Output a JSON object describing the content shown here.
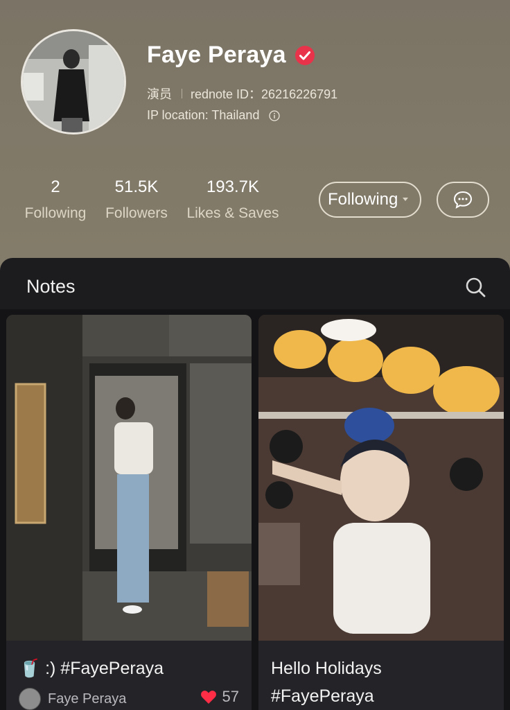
{
  "profile": {
    "name": "Faye Peraya",
    "role": "演员",
    "rednote_id": "rednote ID：26216226791",
    "ip_location": "IP location: Thailand"
  },
  "stats": [
    {
      "value": "2",
      "label": "Following"
    },
    {
      "value": "51.5K",
      "label": "Followers"
    },
    {
      "value": "193.7K",
      "label": "Likes & Saves"
    }
  ],
  "actions": {
    "following_label": "Following",
    "chat_icon": "chat-bubble-icon"
  },
  "notes": {
    "title": "Notes",
    "cards": [
      {
        "caption_emoji": "🥤",
        "caption": ":) #FayePeraya",
        "author": "Faye Peraya",
        "likes": "57"
      },
      {
        "caption_line1": "Hello Holidays",
        "caption_line2": "#FayePeraya"
      }
    ]
  },
  "colors": {
    "verified": "#e8334a",
    "heart": "#ff2d46",
    "panel_bg": "#1c1c1f"
  }
}
